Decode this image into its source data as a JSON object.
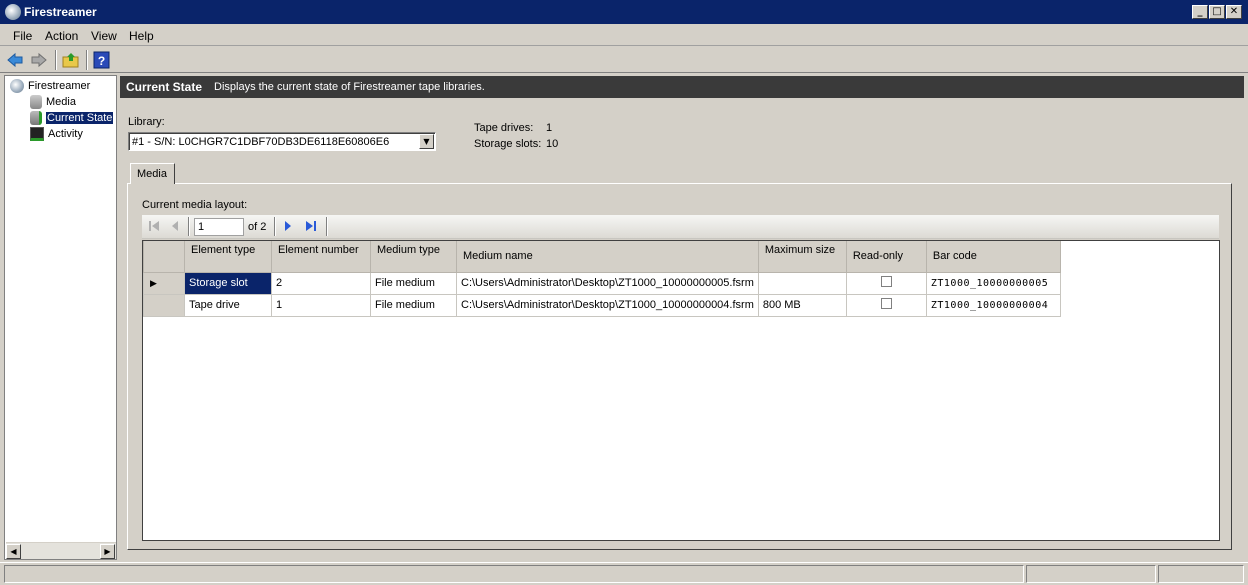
{
  "window": {
    "title": "Firestreamer"
  },
  "menu": [
    {
      "label": "File"
    },
    {
      "label": "Action"
    },
    {
      "label": "View"
    },
    {
      "label": "Help"
    }
  ],
  "toolbar": {
    "icons": [
      "back-arrow-icon",
      "forward-arrow-icon",
      "up-folder-icon",
      "help-icon"
    ]
  },
  "tree": {
    "root": "Firestreamer",
    "items": [
      {
        "label": "Media"
      },
      {
        "label": "Current State"
      },
      {
        "label": "Activity"
      }
    ],
    "selected": "Current State"
  },
  "header": {
    "title": "Current State",
    "description": "Displays the current state of Firestreamer tape libraries."
  },
  "library": {
    "label": "Library:",
    "selected": "#1 - S/N: L0CHGR7C1DBF70DB3DE6118E60806E6",
    "tape_drives_label": "Tape drives:",
    "tape_drives": "1",
    "storage_slots_label": "Storage slots:",
    "storage_slots": "10"
  },
  "tabs": [
    {
      "label": "Media"
    }
  ],
  "media": {
    "layout_label": "Current media layout:",
    "pager": {
      "page": "1",
      "of": "of 2"
    },
    "columns": [
      "Element type",
      "Element number",
      "Medium type",
      "Medium name",
      "Maximum size",
      "Read-only",
      "Bar code"
    ],
    "rows": [
      {
        "element_type": "Storage slot",
        "element_number": "2",
        "medium_type": "File medium",
        "medium_name": "C:\\Users\\Administrator\\Desktop\\ZT1000_10000000005.fsrm",
        "maximum_size": "",
        "read_only": false,
        "bar_code": "ZT1000_10000000005"
      },
      {
        "element_type": "Tape drive",
        "element_number": "1",
        "medium_type": "File medium",
        "medium_name": "C:\\Users\\Administrator\\Desktop\\ZT1000_10000000004.fsrm",
        "maximum_size": "800 MB",
        "read_only": false,
        "bar_code": "ZT1000_10000000004"
      }
    ]
  }
}
